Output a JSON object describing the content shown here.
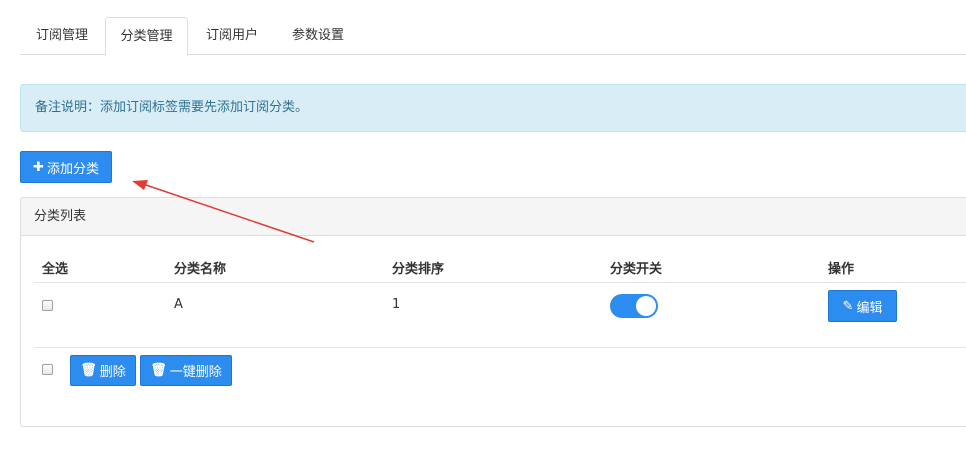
{
  "tabs": [
    {
      "label": "订阅管理",
      "active": false
    },
    {
      "label": "分类管理",
      "active": true
    },
    {
      "label": "订阅用户",
      "active": false
    },
    {
      "label": "参数设置",
      "active": false
    }
  ],
  "notice": "备注说明：添加订阅标签需要先添加订阅分类。",
  "add_button": {
    "icon": "plus-icon",
    "label": "添加分类"
  },
  "panel": {
    "title": "分类列表"
  },
  "table": {
    "headers": [
      "全选",
      "分类名称",
      "分类排序",
      "分类开关",
      "操作"
    ],
    "rows": [
      {
        "name": "A",
        "order": "1",
        "enabled": true,
        "action": {
          "icon": "edit-icon",
          "label": "编辑"
        }
      }
    ]
  },
  "footer_buttons": {
    "delete": {
      "icon": "trash-icon",
      "label": "删除"
    },
    "delete_all": {
      "icon": "trash-icon",
      "label": "一键删除"
    }
  },
  "colors": {
    "primary": "#2d8cf0",
    "alert_bg": "#d9edf7",
    "alert_text": "#31708f",
    "annotation_arrow": "#e53935"
  }
}
